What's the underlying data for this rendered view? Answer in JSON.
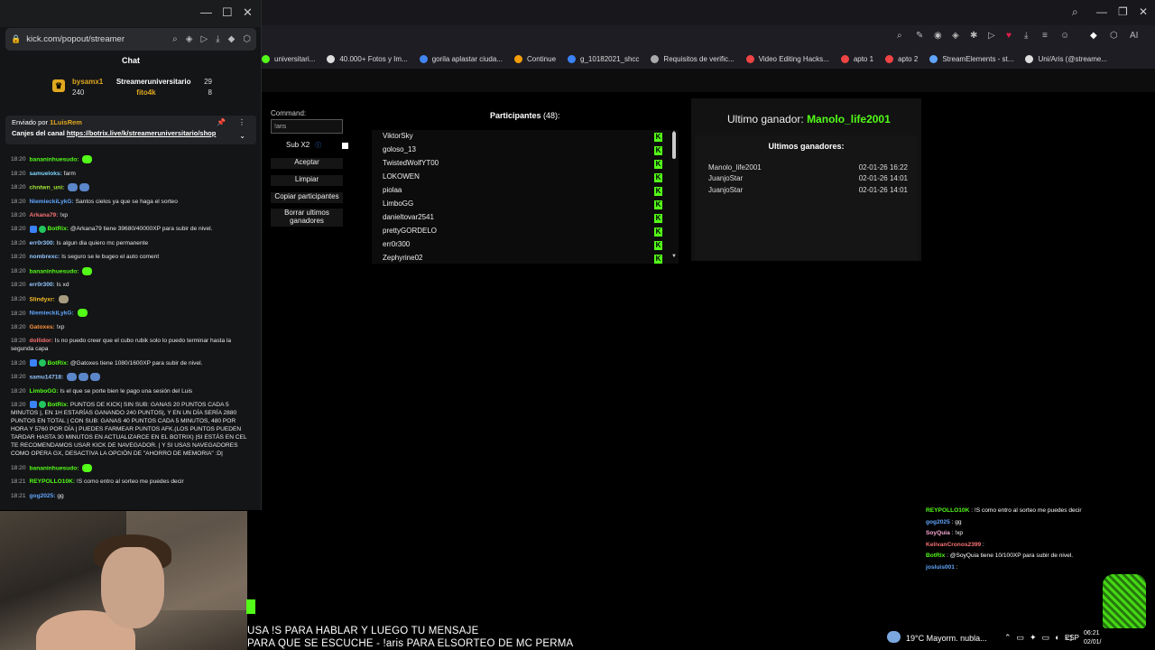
{
  "popout": {
    "url": "kick.com/popout/streamer",
    "chat_title": "Chat",
    "leaders": [
      {
        "name": "bysamx1",
        "points": "29",
        "name2": "Streameruniversitario"
      },
      {
        "name": "240",
        "name2": "fito4k",
        "points": "8"
      }
    ],
    "pinned": {
      "sender": "Enviado por",
      "pinner": "1LuisRem",
      "text": "Canjes del canal",
      "link": "https://botrix.live/k/streameruniversitario/shop"
    },
    "messages": [
      {
        "t": "18:20",
        "u": "bananinhuesudo:",
        "c": "#53fc18",
        "m": "",
        "emo": "g1"
      },
      {
        "t": "18:20",
        "u": "samueloks:",
        "c": "#7dd3fc",
        "m": "farm"
      },
      {
        "t": "18:20",
        "u": "chntwn_uni:",
        "c": "#a3e635",
        "m": "",
        "emo": "b2"
      },
      {
        "t": "18:20",
        "u": "NiemieckiLykG:",
        "c": "#60a5fa",
        "m": "Santos cielos ya que se haga el sorteo"
      },
      {
        "t": "18:20",
        "u": "Arkana79:",
        "c": "#f87171",
        "m": "!xp"
      },
      {
        "t": "18:20",
        "u": "BotRix:",
        "c": "#53fc18",
        "m": "@Arkana79 tiene 39680/40000XP para subir de nivel.",
        "bot": true
      },
      {
        "t": "18:20",
        "u": "err0r300:",
        "c": "#93c5fd",
        "m": "Is algun dia quiero mc permanente"
      },
      {
        "t": "18:20",
        "u": "nombrexc:",
        "c": "#93c5fd",
        "m": "Is seguro se le bugeo el auto coment"
      },
      {
        "t": "18:20",
        "u": "bananinhuesudo:",
        "c": "#53fc18",
        "m": "",
        "emo": "g1"
      },
      {
        "t": "18:20",
        "u": "err0r300:",
        "c": "#93c5fd",
        "m": "Is xd"
      },
      {
        "t": "18:20",
        "u": "Slindyxr:",
        "c": "#fbbf24",
        "m": "",
        "emo": "n1"
      },
      {
        "t": "18:20",
        "u": "NiemieckiLykG:",
        "c": "#60a5fa",
        "m": "",
        "emo": "g1"
      },
      {
        "t": "18:20",
        "u": "Gatoxes:",
        "c": "#fb923c",
        "m": "!xp"
      },
      {
        "t": "18:20",
        "u": "dollidor:",
        "c": "#f87171",
        "m": "Is no puedo creer que el cubo rubik solo lo puedo terminar hasta la segunda capa"
      },
      {
        "t": "18:20",
        "u": "BotRix:",
        "c": "#53fc18",
        "m": "@Gatoxes tiene 1080/1600XP para subir de nivel.",
        "bot": true
      },
      {
        "t": "18:20",
        "u": "samu14718:",
        "c": "#93c5fd",
        "m": "",
        "emo": "b3"
      },
      {
        "t": "18:20",
        "u": "LimboGG:",
        "c": "#53fc18",
        "m": "Is el que se porte bien le pago una sesión del Luis"
      },
      {
        "t": "18:20",
        "u": "BotRix:",
        "c": "#53fc18",
        "m": "PUNTOS DE KICK| SIN SUB: GANAS 20 PUNTOS CADA 5 MINUTOS |, EN 1H ESTARÍAS GANANDO 240 PUNTOS|, Y EN UN DÍA SERÍA 2880 PUNTOS EN TOTAL | CON SUB: GANAS 40 PUNTOS CADA 5 MINUTOS, 480 POR HORA Y 5760 POR DÍA | PUEDES FARMEAR PUNTOS AFK.(LOS PUNTOS PUEDEN TARDAR HASTA 30 MINUTOS EN ACTUALIZARCE EN EL BOTRIX) |SI ESTÁS EN CEL TE RECOMENDAMOS USAR KICK DE NAVEGADOR. | Y SI USAS NAVEGADORES COMO OPERA GX, DESACTIVA LA OPCIÓN DE \"AHORRO DE MEMORIA\" :D|",
        "bot": true
      },
      {
        "t": "18:20",
        "u": "bananinhuesudo:",
        "c": "#53fc18",
        "m": "",
        "emo": "g1"
      },
      {
        "t": "18:21",
        "u": "REYPOLLO10K:",
        "c": "#53fc18",
        "m": "!S como entro al sorteo me puedes decir"
      },
      {
        "t": "18:21",
        "u": "gog2025:",
        "c": "#60a5fa",
        "m": "gg"
      }
    ]
  },
  "browser": {
    "bookmarks": [
      {
        "label": "universitari...",
        "color": "#53fc18"
      },
      {
        "label": "40.000+ Fotos y Im...",
        "color": "#dddddd"
      },
      {
        "label": "gorila aplastar ciuda...",
        "color": "#4285f4"
      },
      {
        "label": "Continue",
        "color": "#f59e0b"
      },
      {
        "label": "g_10182021_shcc",
        "color": "#3b82f6"
      },
      {
        "label": "Requisitos de verific...",
        "color": "#aaaaaa"
      },
      {
        "label": "Video Editing Hacks...",
        "color": "#ef4444"
      },
      {
        "label": "apto 1",
        "color": "#ef4444"
      },
      {
        "label": "apto 2",
        "color": "#ef4444"
      },
      {
        "label": "StreamElements - st...",
        "color": "#60a5fa"
      },
      {
        "label": "Uni/Aris (@streame...",
        "color": "#dddddd"
      }
    ]
  },
  "raffle": {
    "command_label": "Command:",
    "command_value": "!aris",
    "sub_label": "Sub X2",
    "buttons": [
      "Aceptar",
      "Limpiar",
      "Copiar participantes",
      "Borrar ultimos ganadores"
    ],
    "participants_title": "Participantes",
    "participants_count": "(48):",
    "participants": [
      "ViktorSky",
      "goloso_13",
      "TwistedWolfYT00",
      "LOKOWEN",
      "piolaa",
      "LimboGG",
      "danieltovar2541",
      "prettyGORDELO",
      "err0r300",
      "Zephyrine02"
    ],
    "last_winner_label": "Ultimo ganador:",
    "last_winner": "Manolo_life2001",
    "recent_title": "Ultimos ganadores:",
    "recent": [
      {
        "name": "Manolo_life2001",
        "date": "02-01-26 16:22"
      },
      {
        "name": "JuanjoStar",
        "date": "02-01-26 14:01"
      },
      {
        "name": "JuanjoStar",
        "date": "02-01-26 14:01"
      }
    ]
  },
  "overlay_chat": [
    {
      "u": "REYPOLLO10K",
      "c": "#53fc18",
      "m": "!S como entro al sorteo me puedes decir"
    },
    {
      "u": "gog2025",
      "c": "#60a5fa",
      "m": "gg"
    },
    {
      "u": "SoyQuia",
      "c": "#f9a8d4",
      "m": "!xp"
    },
    {
      "u": "KelivanCronos2399",
      "c": "#f87171",
      "m": ""
    },
    {
      "u": "BotRix",
      "c": "#53fc18",
      "m": "@SoyQuia tiene 10/100XP para subir de nivel."
    },
    {
      "u": "josluis001",
      "c": "#60a5fa",
      "m": ""
    }
  ],
  "subtitle": {
    "line1": "USA !S PARA HABLAR Y LUEGO TU MENSAJE",
    "line2": "PARA QUE SE ESCUCHE - !aris PARA ELSORTEO DE MC PERMA"
  },
  "taskbar": {
    "temp": "19°C",
    "weather": "Mayorm. nubla...",
    "lang": "ESP",
    "time": "06:21",
    "date": "02/01/"
  }
}
